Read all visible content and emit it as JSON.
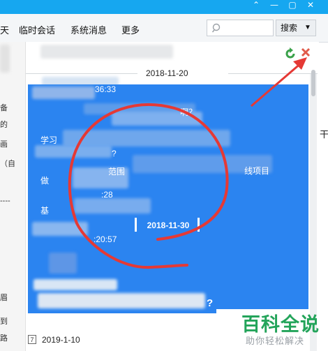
{
  "toolbar": {
    "partial_tab": "天",
    "temp_session": "临时会话",
    "system_messages": "系统消息",
    "more": "更多",
    "search_placeholder": "",
    "search_button": "搜索"
  },
  "left_strip": {
    "chars": [
      "备",
      "的",
      "画",
      "（自",
      "----",
      "眉",
      "到",
      "路"
    ]
  },
  "conversation": {
    "date_separator_1": "2018-11-20",
    "time_1": "36:33",
    "msg_fragment_1": "啊？",
    "msg_fragment_2": "学习",
    "msg_fragment_3": "?",
    "msg_fragment_4": "做",
    "msg_fragment_5": "范围",
    "msg_fragment_6": "线项目",
    "msg_fragment_7": ":28",
    "msg_fragment_8": "基",
    "date_separator_2": "2018-11-30",
    "time_2": ":20:57",
    "msg_fragment_9": "?",
    "bottom_date": "2019-1-10",
    "calendar_icon_glyph": "7",
    "right_edge_partial": "干"
  },
  "watermark": {
    "title": "百科全说",
    "subtitle": "助你轻松解决"
  },
  "colors": {
    "titlebar": "#16a7f0",
    "selection": "#2b84f0",
    "annotation_red": "#e53935",
    "watermark_green": "#23a45a"
  },
  "icons": {
    "refresh": "refresh-icon",
    "close": "close-icon",
    "search": "search-icon",
    "dropdown": "chevron-down-icon",
    "calendar": "calendar-icon"
  }
}
